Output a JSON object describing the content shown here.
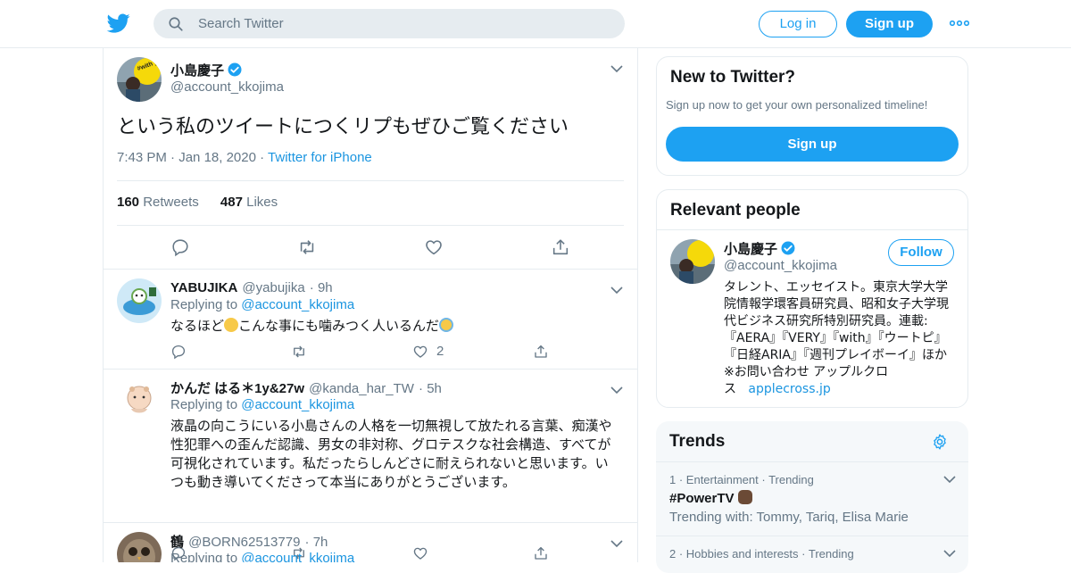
{
  "header": {
    "search_placeholder": "Search Twitter",
    "login_label": "Log in",
    "signup_label": "Sign up",
    "brand_color": "#1da1f2"
  },
  "main_tweet": {
    "name": "小島慶子",
    "handle": "@account_kkojima",
    "avatar_badge_text": "#with yellow",
    "text": "という私のツイートにつくリプもぜひご覧ください",
    "time": "7:43 PM",
    "date": "Jan 18, 2020",
    "source": "Twitter for iPhone",
    "retweets_count": "160",
    "retweets_label": "Retweets",
    "likes_count": "487",
    "likes_label": "Likes"
  },
  "replies": [
    {
      "name": "YABUJIKA",
      "handle": "@yabujika",
      "time": "9h",
      "replying_prefix": "Replying to",
      "replying_to": "@account_kkojima",
      "text_before": "なるほど",
      "text_middle": "こんな事にも噛みつく人いるんだ",
      "text": "",
      "like_count": "2"
    },
    {
      "name": "かんだ はる＊1y&27w",
      "handle": "@kanda_har_TW",
      "time": "5h",
      "replying_prefix": "Replying to",
      "replying_to": "@account_kkojima",
      "text": "液晶の向こうにいる小島さんの人格を一切無視して放たれる言葉、痴漢や性犯罪への歪んだ認識、男女の非対称、グロテスクな社会構造、すべてが可視化されています。私だったらしんどさに耐えられないと思います。いつも動き導いてくださって本当にありがとうございます。",
      "like_count": ""
    },
    {
      "name": "鶴",
      "handle": "@BORN62513779",
      "time": "7h",
      "replying_prefix": "Replying to",
      "replying_to": "@account_kkojima",
      "text": "",
      "like_count": ""
    }
  ],
  "new_to_twitter": {
    "title": "New to Twitter?",
    "subtitle": "Sign up now to get your own personalized timeline!",
    "button": "Sign up"
  },
  "relevant_people": {
    "title": "Relevant people",
    "name": "小島慶子",
    "handle": "@account_kkojima",
    "follow_label": "Follow",
    "bio": "タレント、エッセイスト。東京大学大学院情報学環客員研究員、昭和女子大学現代ビジネス研究所特別研究員。連載: 『AERA』『VERY』『with』『ウートピ』『日経ARIA』『週刊プレイボーイ』ほか ※お問い合わせ アップルクロス",
    "bio_link": "applecross.jp"
  },
  "trends": {
    "title": "Trends",
    "items": [
      {
        "rank": "1",
        "category": "Entertainment",
        "status": "Trending",
        "tag": "#PowerTV",
        "with_label": "Trending with: Tommy, Tariq, Elisa Marie"
      },
      {
        "rank": "2",
        "category": "Hobbies and interests",
        "status": "Trending",
        "tag": "",
        "with_label": ""
      }
    ]
  }
}
